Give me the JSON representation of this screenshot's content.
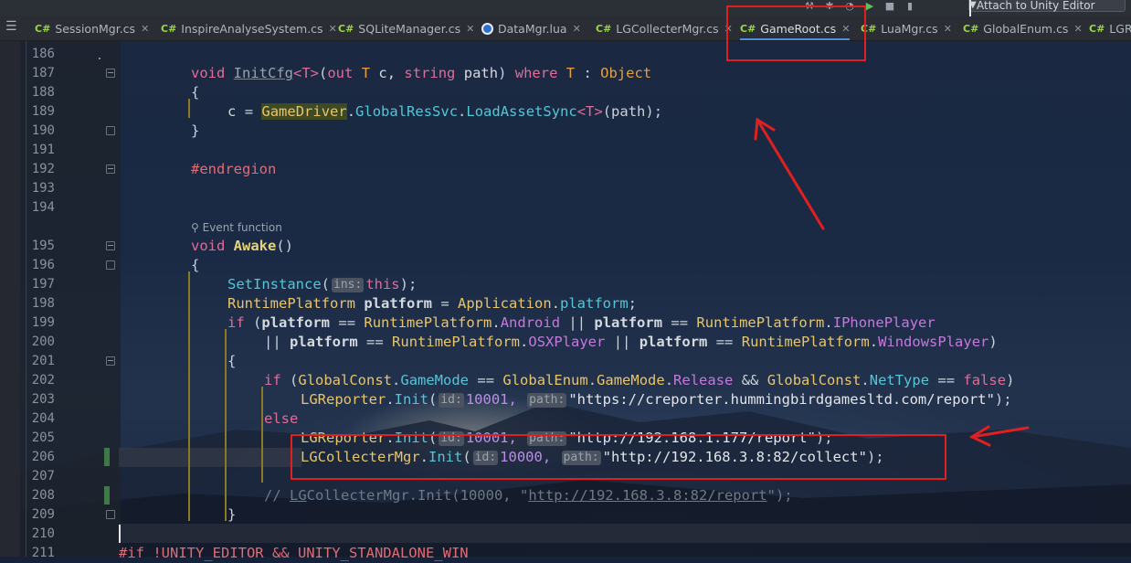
{
  "toolbar": {
    "attach_label": "Attach to Unity Editor",
    "icons": [
      "hammer-icon",
      "bug-icon",
      "run-icon",
      "stop-icon",
      "bookmark-icon"
    ]
  },
  "tabs": [
    {
      "kind": "C#",
      "label": "SessionMgr.cs",
      "active": false
    },
    {
      "kind": "C#",
      "label": "InspireAnalyseSystem.cs",
      "active": false
    },
    {
      "kind": "C#",
      "label": "SQLiteManager.cs",
      "active": false
    },
    {
      "kind": "lua",
      "label": "DataMgr.lua",
      "active": false
    },
    {
      "kind": "C#",
      "label": "LGCollecterMgr.cs",
      "active": false
    },
    {
      "kind": "C#",
      "label": "GameRoot.cs",
      "active": true
    },
    {
      "kind": "C#",
      "label": "LuaMgr.cs",
      "active": false
    },
    {
      "kind": "C#",
      "label": "GlobalEnum.cs",
      "active": false
    },
    {
      "kind": "C#",
      "label": "LGRe",
      "active": false
    }
  ],
  "close_glyph": "✕",
  "line_numbers": [
    "186",
    "187",
    "188",
    "189",
    "190",
    "191",
    "192",
    "193",
    "194",
    "195",
    "196",
    "197",
    "198",
    "199",
    "200",
    "201",
    "202",
    "203",
    "204",
    "205",
    "206",
    "207",
    "208",
    "209",
    "210",
    "211"
  ],
  "code_lens": "Event function",
  "code": {
    "l187": {
      "void": "void",
      "name": "InitCfg",
      "gen": "<T>",
      "p1": "(",
      "out": "out",
      "T": "T",
      "c": "c,",
      "string": "string",
      "path": "path",
      "p2": ")",
      "where": "where",
      "T2": "T",
      "colon": ":",
      "Object": "Object"
    },
    "l188": "{",
    "l189": {
      "c": "c",
      "eq": "=",
      "GameDriver": "GameDriver",
      "dot1": ".",
      "GlobalResSvc": "GlobalResSvc",
      "dot2": ".",
      "method": "LoadAssetSync",
      "gen": "<T>",
      "args": "(path);"
    },
    "l190": "}",
    "l192": "#endregion",
    "l195": {
      "void": "void",
      "name": "Awake",
      "rest": "()"
    },
    "l196": "{",
    "l197": {
      "method": "SetInstance",
      "p1": "(",
      "hint": "ins:",
      "this": "this",
      "p2": ");"
    },
    "l198": {
      "type": "RuntimePlatform",
      "var": "platform",
      "eq": "=",
      "cls": "Application",
      "dot": ".",
      "prop": "platform",
      "end": ";"
    },
    "l199": {
      "if": "if",
      "p": "(",
      "v1": "platform",
      "eq1": "==",
      "t1": "RuntimePlatform",
      "d1": ".",
      "e1": "Android",
      "or": "||",
      "v2": "platform",
      "eq2": "==",
      "t2": "RuntimePlatform",
      "d2": ".",
      "e2": "IPhonePlayer"
    },
    "l200": {
      "or1": "||",
      "v1": "platform",
      "eq1": "==",
      "t1": "RuntimePlatform",
      "d1": ".",
      "e1": "OSXPlayer",
      "or2": "||",
      "v2": "platform",
      "eq2": "==",
      "t2": "RuntimePlatform",
      "d2": ".",
      "e2": "WindowsPlayer",
      "end": ")"
    },
    "l201": "{",
    "l202": {
      "if": "if",
      "p": "(",
      "c1": "GlobalConst",
      "d1": ".",
      "m1": "GameMode",
      "eq": "==",
      "c2": "GlobalEnum",
      "d2": ".",
      "c3": "GameMode",
      "d3": ".",
      "m2": "Release",
      "and": "&&",
      "c4": "GlobalConst",
      "d4": ".",
      "m3": "NetType",
      "eq2": "==",
      "f": "false",
      "end": ")"
    },
    "l203": {
      "cls": "LGReporter",
      "dot": ".",
      "method": "Init",
      "p": "(",
      "h1": "id:",
      "n": "10001,",
      "h2": "path:",
      "s": "\"https://creporter.hummingbirdgamesltd.com/report\"",
      "end": ");"
    },
    "l204": "else",
    "l205": {
      "cls": "LGReporter",
      "dot": ".",
      "method": "Init",
      "p": "(",
      "h1": "id:",
      "n": "10001,",
      "h2": "path:",
      "s": "\"http://192.168.1.177/report\"",
      "end": ");"
    },
    "l206": {
      "cls": "LGCollecterMgr",
      "dot": ".",
      "method": "Init",
      "p": "(",
      "h1": "id:",
      "n": "10000,",
      "h2": "path:",
      "s": "\"http://192.168.3.8:82/collect\"",
      "end": ");"
    },
    "l208": {
      "c1": "// ",
      "c2": "LG",
      "c3": "CollecterMgr.Init(10000, \"",
      "url": "http://192.168.3.8:82/report",
      "c4": "\");"
    },
    "l209": "}",
    "l211": "#if !UNITY_EDITOR && UNITY_STANDALONE_WIN"
  },
  "annotation_color": "#e02020"
}
